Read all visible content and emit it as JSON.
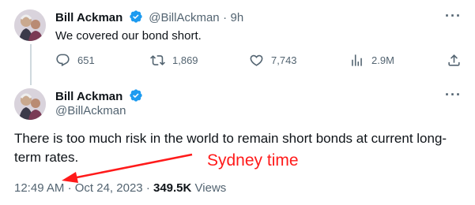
{
  "tweet1": {
    "name": "Bill Ackman",
    "handle": "@BillAckman",
    "separator": "·",
    "time_ago": "9h",
    "text": "We covered our bond short.",
    "more_label": "···",
    "actions": {
      "replies": "651",
      "retweets": "1,869",
      "likes": "7,743",
      "views": "2.9M"
    }
  },
  "tweet2": {
    "name": "Bill Ackman",
    "handle": "@BillAckman",
    "more_label": "···",
    "text": "There is too much risk in the world to remain short bonds at current long-term rates.",
    "time": "12:49 AM",
    "separator": "·",
    "date": "Oct 24, 2023",
    "separator2": "·",
    "views_count": "349.5K",
    "views_label": "Views"
  },
  "annotation": {
    "label": "Sydney time",
    "color": "#ff1a1a"
  },
  "colors": {
    "verified": "#1d9bf0",
    "muted": "#536471",
    "text": "#0f1419"
  }
}
